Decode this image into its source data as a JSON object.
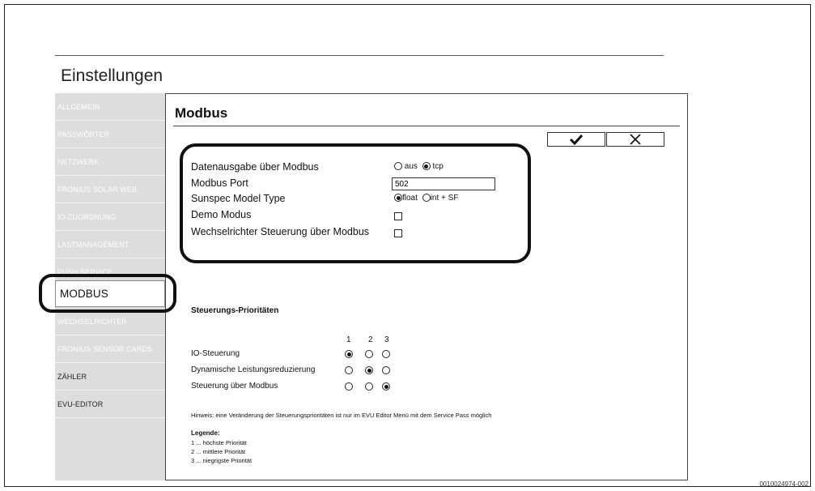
{
  "page_title": "Einstellungen",
  "sidebar": {
    "items": [
      {
        "label": "ALLGEMEIN"
      },
      {
        "label": "PASSWÖRTER"
      },
      {
        "label": "NETZWERK"
      },
      {
        "label": "FRONIUS SOLAR.WEB"
      },
      {
        "label": "IO-ZUORDNUNG"
      },
      {
        "label": "LASTMANAGEMENT"
      },
      {
        "label": "PUSH SERVICE"
      },
      {
        "label": "MODBUS"
      },
      {
        "label": "WECHSELRICHTER"
      },
      {
        "label": "FRONIUS SENSOR CARDS"
      },
      {
        "label": "ZÄHLER"
      },
      {
        "label": "EVU-EDITOR"
      }
    ],
    "active": "MODBUS"
  },
  "main": {
    "title": "Modbus",
    "confirm_icon": "checkmark-icon",
    "cancel_icon": "close-icon",
    "settings": {
      "datenausgabe_label": "Datenausgabe über Modbus",
      "datenausgabe_options": [
        "aus",
        "tcp"
      ],
      "datenausgabe_selected": "tcp",
      "port_label": "Modbus Port",
      "port_value": "502",
      "sunspec_label": "Sunspec Model Type",
      "sunspec_options": [
        "float",
        "int + SF"
      ],
      "sunspec_selected": "float",
      "demo_label": "Demo Modus",
      "demo_checked": false,
      "wr_label": "Wechselrichter Steuerung über Modbus",
      "wr_checked": false
    },
    "priorities": {
      "heading": "Steuerungs-Prioritäten",
      "columns": [
        "1",
        "2",
        "3"
      ],
      "rows": [
        {
          "label": "IO-Steuerung",
          "selected": 1
        },
        {
          "label": "Dynamische Leistungsreduzierung",
          "selected": 2
        },
        {
          "label": "Steuerung über Modbus",
          "selected": 3
        }
      ],
      "hint": "Hinweis: eine Veränderung der Steuerungsprioritäten ist nur im EVU Editor Menü mit dem Service Pass möglich",
      "legend_title": "Legende:",
      "legend": [
        "1 ... höchste Priorität",
        "2 ... mittlere Priorität",
        "3 ... niegrigste Priorität"
      ]
    }
  },
  "figure_ref": "0010024974-002"
}
